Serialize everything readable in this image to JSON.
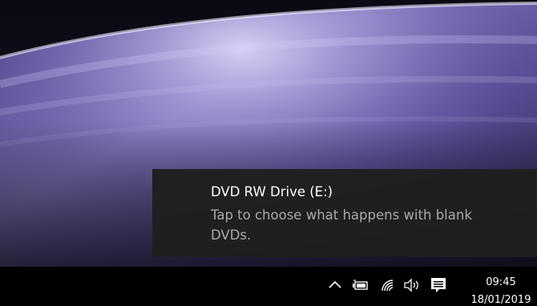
{
  "notification": {
    "title": "DVD RW Drive (E:)",
    "message": "Tap to choose what happens with blank DVDs."
  },
  "taskbar": {
    "tray_icons": [
      "chevron-up-icon",
      "battery-icon",
      "wifi-icon",
      "volume-icon",
      "action-center-icon"
    ],
    "clock": {
      "time": "09:45",
      "date": "18/01/2019"
    }
  },
  "colors": {
    "toast_background": "#1f1f1f",
    "toast_title": "#ffffff",
    "toast_message": "#a9a9a9",
    "taskbar_background": "#000000"
  }
}
